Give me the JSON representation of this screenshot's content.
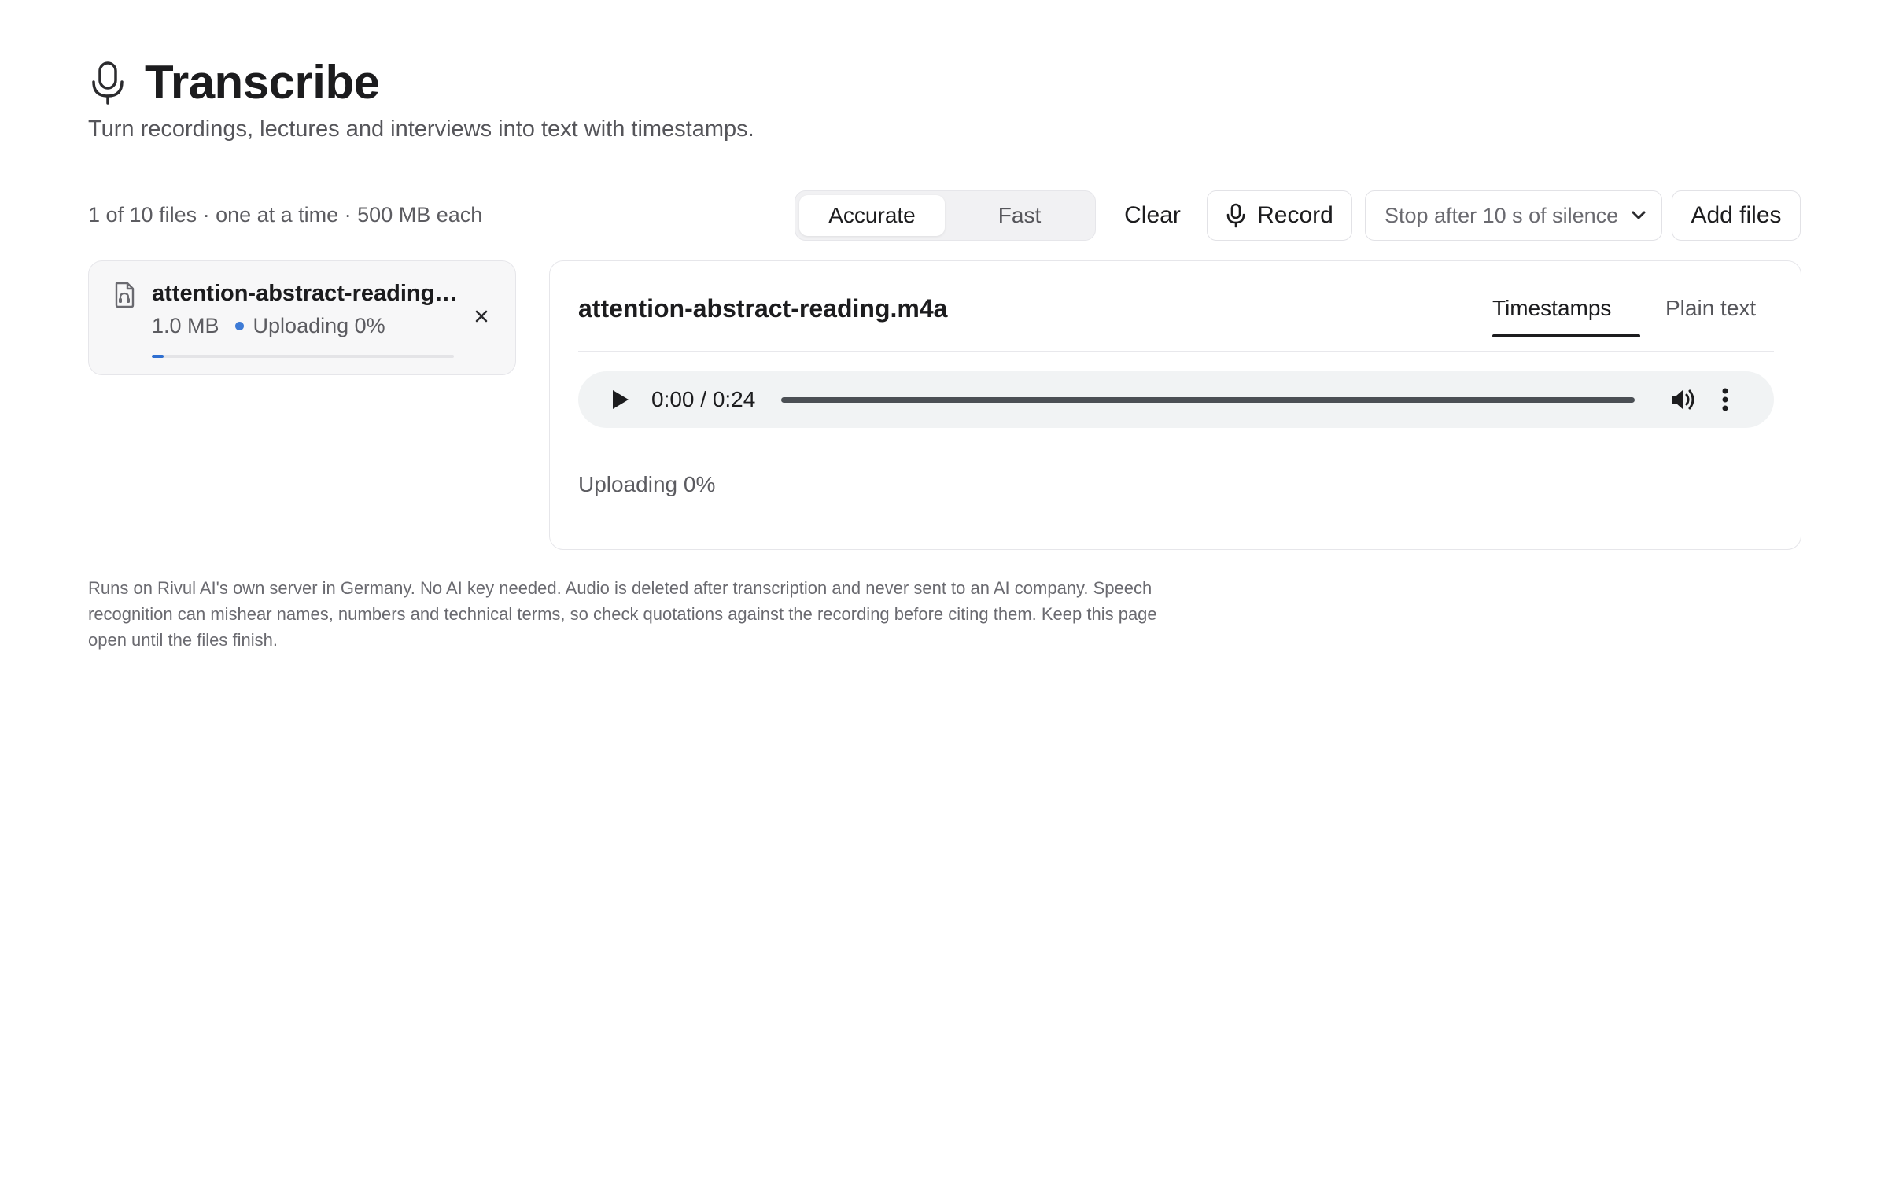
{
  "header": {
    "title": "Transcribe",
    "subtitle": "Turn recordings, lectures and interviews into text with timestamps.",
    "icon": "microphone-icon"
  },
  "toolbar": {
    "status": "1 of 10 files · one at a time · 500 MB each",
    "mode_options": [
      "Accurate",
      "Fast"
    ],
    "mode_selected": "Accurate",
    "clear_label": "Clear",
    "record_label": "Record",
    "silence_select_value": "Stop after 10 s of silence",
    "add_files_label": "Add files"
  },
  "file_list": [
    {
      "name": "attention-abstract-reading…",
      "size": "1.0 MB",
      "status": "Uploading 0%",
      "progress_fraction": 0.04,
      "icon": "audio-file-icon",
      "status_color": "#3e7bd6"
    }
  ],
  "detail": {
    "file_name": "attention-abstract-reading.m4a",
    "tabs": [
      "Timestamps",
      "Plain text"
    ],
    "active_tab": "Timestamps",
    "player": {
      "time": "0:00 / 0:24"
    },
    "status": "Uploading 0%"
  },
  "footnote": "Runs on Rivul AI's own server in Germany. No AI key needed. Audio is deleted after transcription and never sent to an AI company. Speech recognition can mishear names, numbers and technical terms, so check quotations against the recording before citing them. Keep this page open until the files finish.",
  "colors": {
    "accent": "#2f6fd1",
    "text": "#1c1c1e",
    "muted": "#5c5c61"
  }
}
